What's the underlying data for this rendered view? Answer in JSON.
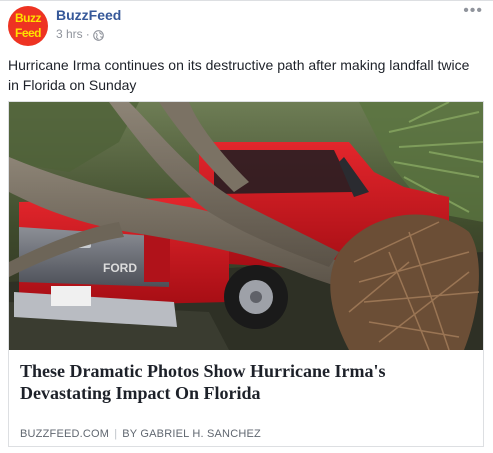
{
  "post": {
    "page_name": "BuzzFeed",
    "avatar_text_line1": "Buzz",
    "avatar_text_line2": "Feed",
    "timestamp": "3 hrs",
    "privacy_icon": "globe-icon",
    "more_icon": "more-options-icon",
    "message": "Hurricane Irma continues on its destructive path after making landfall twice in Florida on Sunday"
  },
  "link_card": {
    "title": "These Dramatic Photos Show Hurricane Irma's Devastating Impact On Florida",
    "domain": "BUZZFEED.COM",
    "separator": "|",
    "byline": "BY GABRIEL H. SANCHEZ",
    "photo_description": "photo",
    "truck_badge": "FORD"
  },
  "colors": {
    "link_blue": "#365899",
    "brand_red": "#ee3322",
    "brand_yellow": "#ffe000",
    "truck_red": "#d8141e"
  }
}
